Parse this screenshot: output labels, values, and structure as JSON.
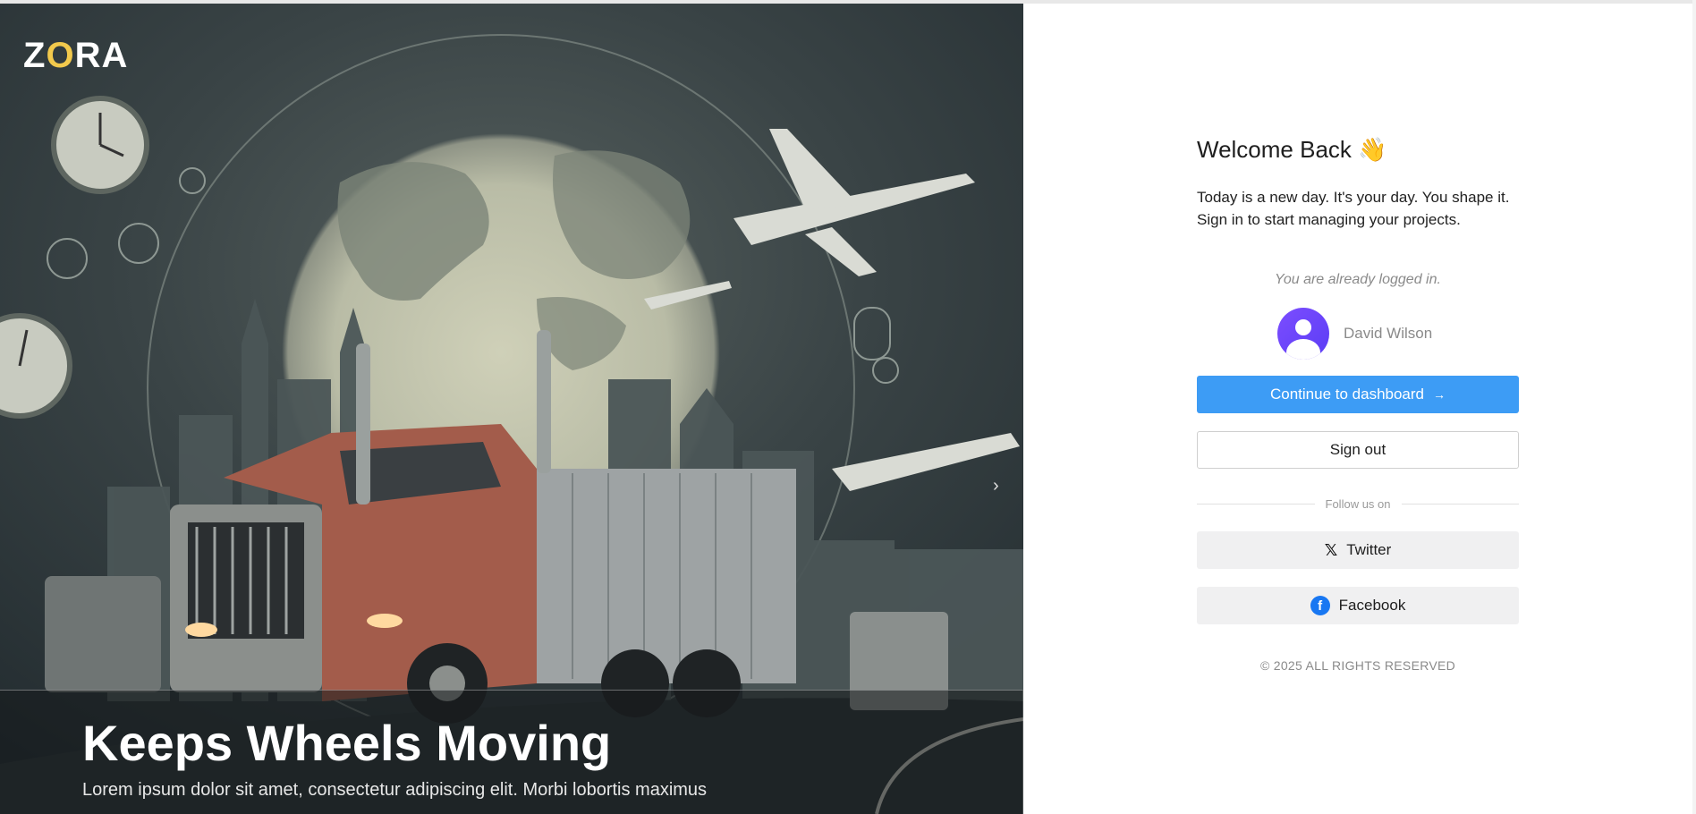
{
  "brand": {
    "logo_text_a": "Z",
    "logo_text_o": "O",
    "logo_text_b": "RA"
  },
  "hero": {
    "title": "Keeps Wheels Moving",
    "body": "Lorem ipsum dolor sit amet, consectetur adipiscing elit. Morbi lobortis maximus",
    "next_glyph": "›"
  },
  "login": {
    "welcome": "Welcome Back 👋",
    "subtitle_line1": "Today is a new day. It's your day. You shape it.",
    "subtitle_line2": "Sign in to start managing your projects.",
    "already_logged_in": "You are already logged in.",
    "user_name": "David Wilson",
    "continue_label": "Continue to dashboard",
    "continue_arrow": "→",
    "signout_label": "Sign out",
    "follow_label": "Follow us on",
    "twitter_label": "Twitter",
    "facebook_label": "Facebook",
    "copyright": "© 2025 ALL RIGHTS RESERVED"
  },
  "icons": {
    "twitter": "x-logo-icon",
    "facebook": "facebook-icon",
    "avatar": "user-avatar-icon"
  },
  "colors": {
    "primary": "#3d9cf5",
    "avatar": "#6a45f7",
    "facebook": "#1877f2",
    "logo_accent": "#f2c94c"
  }
}
